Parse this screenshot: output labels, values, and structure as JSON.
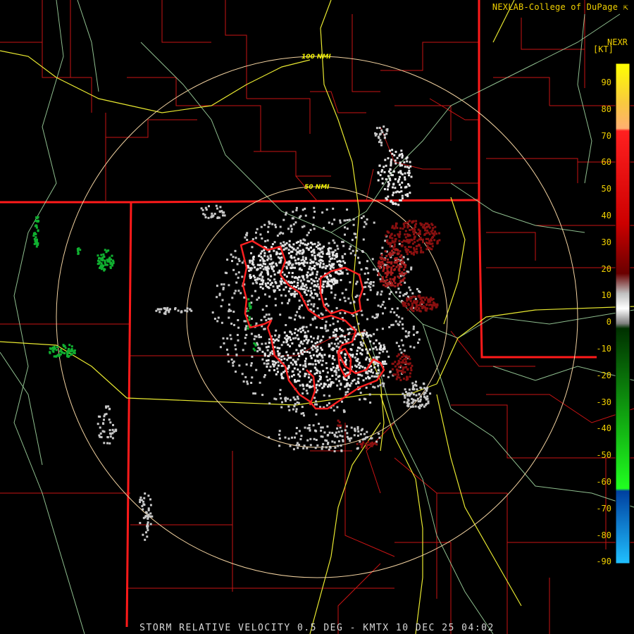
{
  "header": {
    "credit": "NEXLAB-College of DuPage"
  },
  "caption": "STORM RELATIVE VELOCITY 0.5 DEG - KMTX 10 DEC 25 04:02",
  "range_rings": {
    "inner_label": "50 NMI",
    "outer_label": "100 NMI"
  },
  "legend": {
    "title": "NEXR",
    "unit": "[KT]",
    "ticks": [
      "90",
      "80",
      "70",
      "60",
      "50",
      "40",
      "30",
      "20",
      "10",
      "0",
      "-10",
      "-20",
      "-30",
      "-40",
      "-50",
      "-60",
      "-70",
      "-80",
      "-90"
    ]
  },
  "colors": {
    "background": "#000000",
    "state_borders": "#ff1a1a",
    "county_borders": "#c81414",
    "highways": "#e8e830",
    "rivers": "#a8e0a8",
    "range_rings": "#f2d2a0",
    "outbound": "#8b1010",
    "inbound": "#10b030",
    "near_zero": "#c8c8c8",
    "warning_polygons": "#ff2020"
  }
}
